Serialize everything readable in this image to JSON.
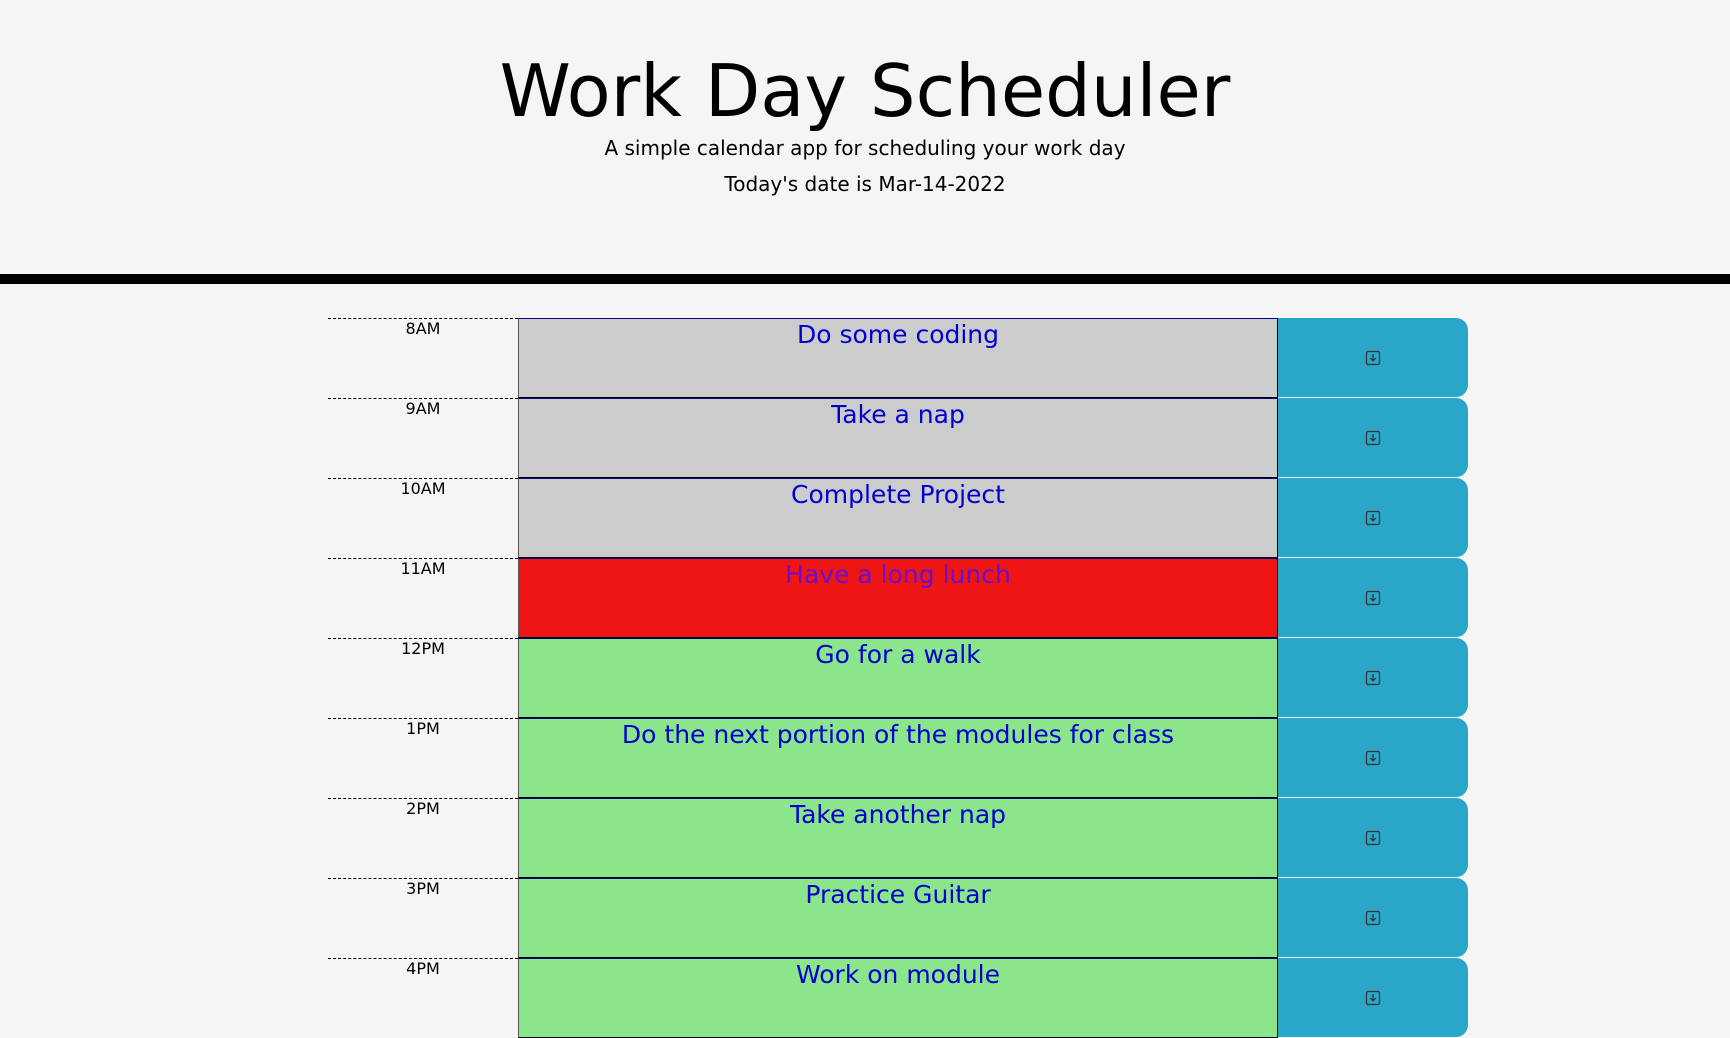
{
  "header": {
    "title": "Work Day Scheduler",
    "subtitle": "A simple calendar app for scheduling your work day",
    "date_line": "Today's date is Mar-14-2022"
  },
  "colors": {
    "past": "#cccccc",
    "present": "#ef1515",
    "future": "#8be58b",
    "save_button": "#2aa6c9",
    "text": "#0000cd"
  },
  "rows": [
    {
      "hour": "8AM",
      "task": "Do some coding",
      "state": "past",
      "icon": "save-icon"
    },
    {
      "hour": "9AM",
      "task": "Take a nap",
      "state": "past",
      "icon": "save-icon"
    },
    {
      "hour": "10AM",
      "task": "Complete Project",
      "state": "past",
      "icon": "save-icon"
    },
    {
      "hour": "11AM",
      "task": "Have a long lunch",
      "state": "present",
      "icon": "save-icon"
    },
    {
      "hour": "12PM",
      "task": "Go for a walk",
      "state": "future",
      "icon": "save-icon"
    },
    {
      "hour": "1PM",
      "task": "Do the next portion of the modules for class",
      "state": "future",
      "icon": "save-icon"
    },
    {
      "hour": "2PM",
      "task": "Take another nap",
      "state": "future",
      "icon": "save-icon"
    },
    {
      "hour": "3PM",
      "task": "Practice Guitar",
      "state": "future",
      "icon": "save-icon"
    },
    {
      "hour": "4PM",
      "task": "Work on module",
      "state": "future",
      "icon": "save-icon"
    }
  ]
}
